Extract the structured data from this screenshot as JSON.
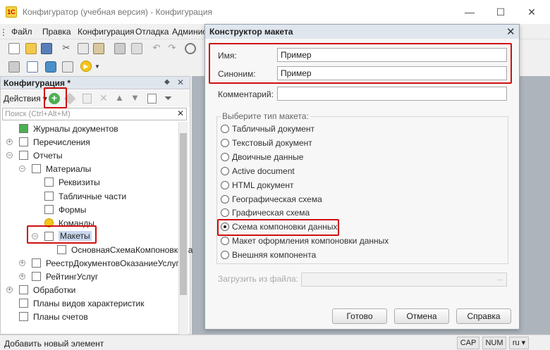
{
  "window": {
    "title": "Конфигуратор (учебная версия) - Конфигурация",
    "controls": [
      "—",
      "☐",
      "✕"
    ]
  },
  "menu": [
    "Файл",
    "Правка",
    "Конфигурация",
    "Отладка",
    "Админис"
  ],
  "left_panel": {
    "title": "Конфигурация *",
    "actions_label": "Действия ▾",
    "search_placeholder": "Поиск (Ctrl+Alt+M)",
    "tree": [
      {
        "label": "Журналы документов",
        "icon": "journal-icon",
        "level": 0,
        "exp": ""
      },
      {
        "label": "Перечисления",
        "icon": "enum-icon",
        "level": 0,
        "exp": "+"
      },
      {
        "label": "Отчеты",
        "icon": "report-icon",
        "level": 0,
        "exp": "−"
      },
      {
        "label": "Материалы",
        "icon": "report-icon",
        "level": 1,
        "exp": "−"
      },
      {
        "label": "Реквизиты",
        "icon": "attribute-icon",
        "level": 2,
        "exp": ""
      },
      {
        "label": "Табличные части",
        "icon": "table-icon",
        "level": 2,
        "exp": ""
      },
      {
        "label": "Формы",
        "icon": "form-icon",
        "level": 2,
        "exp": ""
      },
      {
        "label": "Команды",
        "icon": "command-icon",
        "level": 2,
        "exp": ""
      },
      {
        "label": "Макеты",
        "icon": "template-icon",
        "level": 2,
        "exp": "−",
        "selected": true
      },
      {
        "label": "ОсновнаяСхемаКомпоновкиДа",
        "icon": "template-icon",
        "level": 3,
        "exp": ""
      },
      {
        "label": "РеестрДокументовОказаниеУслуги",
        "icon": "report-icon",
        "level": 1,
        "exp": "+"
      },
      {
        "label": "РейтингУслуг",
        "icon": "report-icon",
        "level": 1,
        "exp": "+"
      },
      {
        "label": "Обработки",
        "icon": "processing-icon",
        "level": 0,
        "exp": "+"
      },
      {
        "label": "Планы видов характеристик",
        "icon": "plan-icon",
        "level": 0,
        "exp": ""
      },
      {
        "label": "Планы счетов",
        "icon": "accounts-icon",
        "level": 0,
        "exp": ""
      }
    ]
  },
  "dialog": {
    "title": "Конструктор макета",
    "name_label": "Имя:",
    "name_value": "Пример",
    "synonym_label": "Синоним:",
    "synonym_value": "Пример",
    "comment_label": "Комментарий:",
    "comment_value": "",
    "group_label": "Выберите тип макета:",
    "types": [
      "Табличный документ",
      "Текстовый документ",
      "Двоичные данные",
      "Active document",
      "HTML документ",
      "Географическая схема",
      "Графическая схема",
      "Схема компоновки данных",
      "Макет оформления компоновки данных",
      "Внешняя компонента"
    ],
    "selected_type": "Схема компоновки данных",
    "load_label": "Загрузить из файла:",
    "load_button": "...",
    "buttons": {
      "ok": "Готово",
      "cancel": "Отмена",
      "help": "Справка"
    }
  },
  "status": {
    "text": "Добавить новый элемент",
    "cap": "CAP",
    "num": "NUM",
    "lang": "ru ▾"
  }
}
